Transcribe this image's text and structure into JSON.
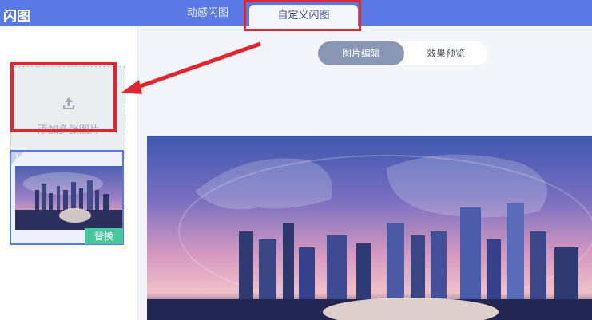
{
  "header": {
    "title": "闪图",
    "tabs": [
      {
        "label": "动感闪图",
        "active": false
      },
      {
        "label": "自定义闪图",
        "active": true
      }
    ]
  },
  "sidebar": {
    "upload": {
      "label": "添加多张图片",
      "icon": "upload-icon"
    },
    "thumbnail": {
      "index": "1",
      "replace_label": "替换"
    }
  },
  "main": {
    "toggle": {
      "edit_label": "图片编辑",
      "preview_label": "效果预览",
      "active": "图片编辑"
    }
  },
  "colors": {
    "header": "#5a79e4",
    "highlight": "#e1262f",
    "replace": "#49c6a0"
  }
}
